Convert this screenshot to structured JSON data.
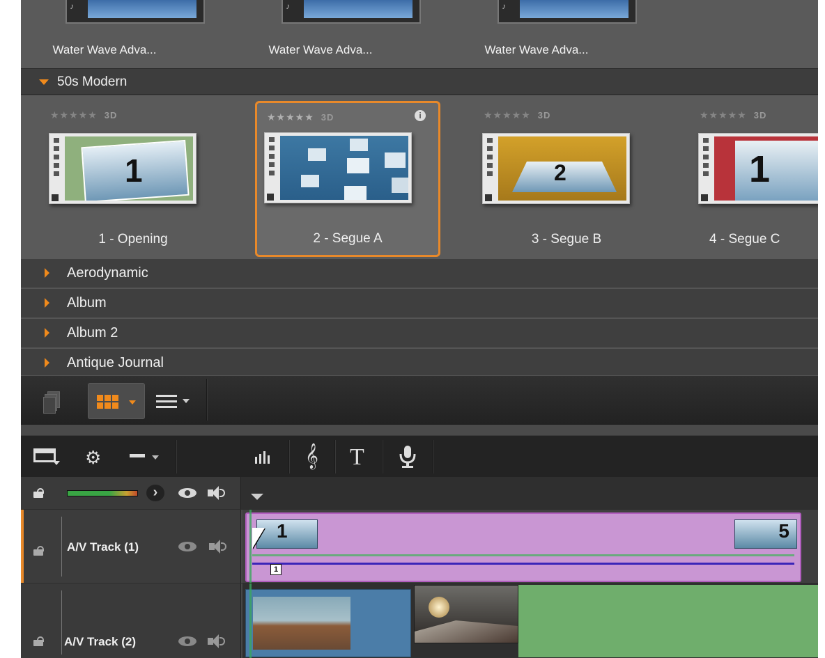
{
  "library": {
    "top_items": [
      {
        "label": "Water Wave Adva..."
      },
      {
        "label": "Water Wave Adva..."
      },
      {
        "label": "Water Wave Adva..."
      }
    ],
    "open_category": "50s Modern",
    "themes": [
      {
        "rating": "★★★★★",
        "tag": "3D",
        "number": "1",
        "label": "1 - Opening"
      },
      {
        "rating": "★★★★★",
        "tag": "3D",
        "number": "",
        "label": "2 - Segue A"
      },
      {
        "rating": "★★★★★",
        "tag": "3D",
        "number": "2",
        "label": "3 - Segue B"
      },
      {
        "rating": "★★★★★",
        "tag": "3D",
        "number": "1",
        "label": "4 - Segue C"
      }
    ],
    "info_glyph": "i",
    "collapsed_categories": [
      {
        "label": "Aerodynamic"
      },
      {
        "label": "Album"
      },
      {
        "label": "Album 2"
      },
      {
        "label": "Antique Journal"
      }
    ]
  },
  "timeline": {
    "tracks": [
      {
        "name": "A/V Track (1)",
        "clip_start_number": "1",
        "clip_end_number": "5",
        "marker": "1"
      },
      {
        "name": "A/V Track (2)"
      }
    ]
  },
  "colors": {
    "accent": "#f08a1c",
    "clip_purple": "#c996d3",
    "clip_green": "#6fae6c",
    "audio_line": "#3b25b8"
  }
}
